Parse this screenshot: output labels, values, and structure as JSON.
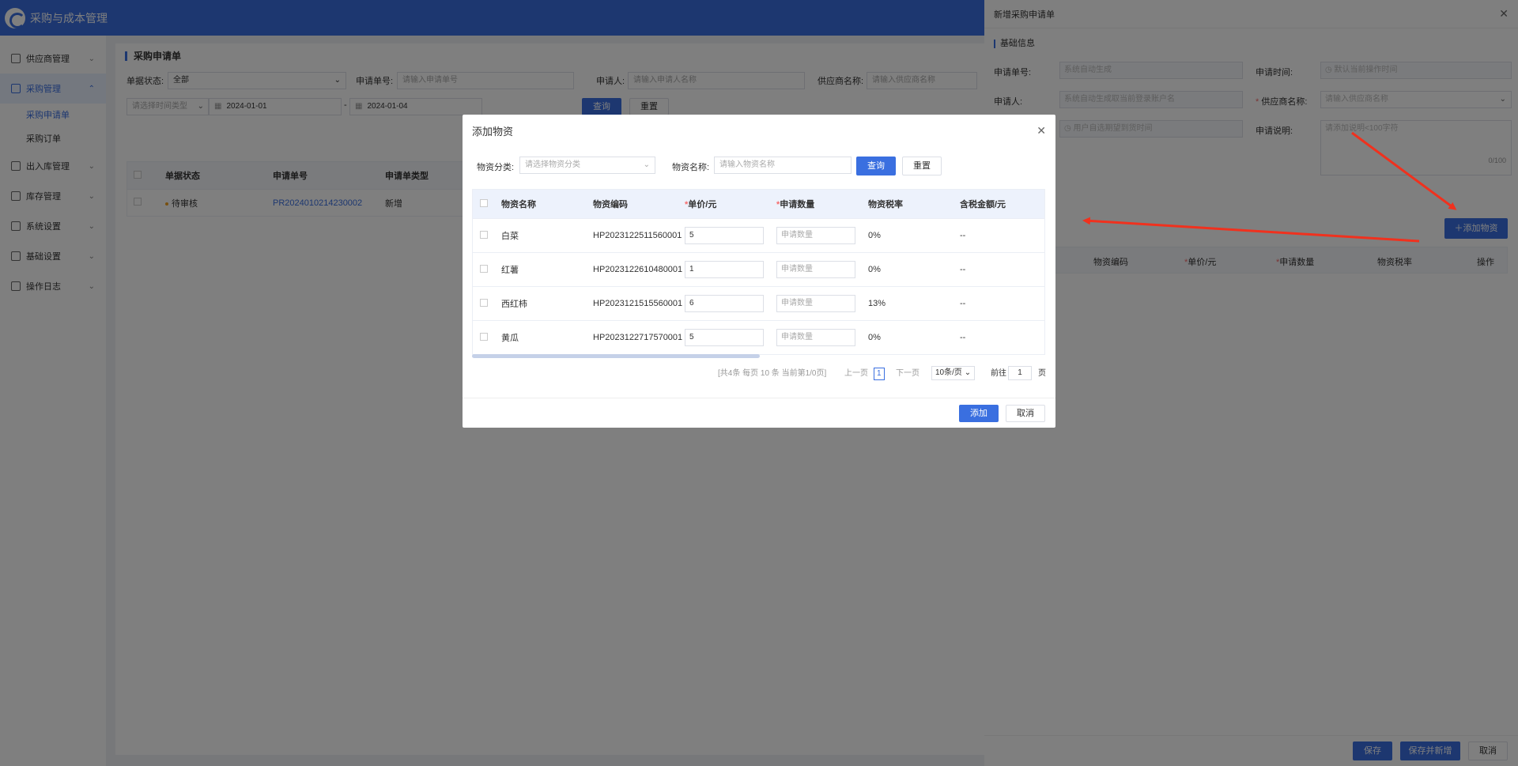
{
  "app": {
    "title": "采购与成本管理"
  },
  "sidebar": {
    "items": [
      {
        "label": "供应商管理"
      },
      {
        "label": "采购管理"
      },
      {
        "label": "出入库管理"
      },
      {
        "label": "库存管理"
      },
      {
        "label": "系统设置"
      },
      {
        "label": "基础设置"
      },
      {
        "label": "操作日志"
      }
    ],
    "sub_items": [
      {
        "label": "采购申请单"
      },
      {
        "label": "采购订单"
      }
    ]
  },
  "page": {
    "title": "采购申请单",
    "filters": {
      "status_label": "单据状态:",
      "status_value": "全部",
      "req_no_label": "申请单号:",
      "req_no_placeholder": "请输入申请单号",
      "applicant_label": "申请人:",
      "applicant_placeholder": "请输入申请人名称",
      "supplier_label": "供应商名称:",
      "supplier_placeholder": "请输入供应商名称",
      "time_type_placeholder": "请选择时间类型",
      "date_start": "2024-01-01",
      "date_sep": "-",
      "date_end": "2024-01-04",
      "query": "查询",
      "reset": "重置"
    },
    "table": {
      "headers": [
        "单据状态",
        "申请单号",
        "申请单类型"
      ],
      "rows": [
        {
          "status": "待审核",
          "no": "PR2024010214230002",
          "type": "新增"
        }
      ]
    }
  },
  "drawer": {
    "title": "新增采购申请单",
    "section": "基础信息",
    "fields": {
      "req_no_label": "申请单号:",
      "req_no_placeholder": "系统自动生成",
      "req_time_label": "申请时间:",
      "req_time_placeholder": "默认当前操作时间",
      "applicant_label": "申请人:",
      "applicant_placeholder": "系统自动生成取当前登录账户名",
      "supplier_label": "供应商名称:",
      "supplier_placeholder": "请输入供应商名称",
      "expected_time_placeholder": "用户自选期望到货时间",
      "desc_label": "申请说明:",
      "desc_placeholder": "请添加说明<100字符",
      "desc_counter": "0/100"
    },
    "add_material": "添加物资",
    "table_headers": [
      "物资编码",
      "单价/元",
      "申请数量",
      "物资税率",
      "操作"
    ],
    "footer": {
      "save": "保存",
      "save_new": "保存并新增",
      "cancel": "取消"
    }
  },
  "modal": {
    "title": "添加物资",
    "filters": {
      "category_label": "物资分类:",
      "category_placeholder": "请选择物资分类",
      "name_label": "物资名称:",
      "name_placeholder": "请输入物资名称",
      "query": "查询",
      "reset": "重置"
    },
    "headers": [
      "物资名称",
      "物资编码",
      "单价/元",
      "申请数量",
      "物资税率",
      "含税金额/元"
    ],
    "qty_placeholder": "申请数量",
    "rows": [
      {
        "name": "白菜",
        "code": "HP2023122511560001",
        "price": "5",
        "tax": "0%",
        "amount": "--"
      },
      {
        "name": "红薯",
        "code": "HP2023122610480001",
        "price": "1",
        "tax": "0%",
        "amount": "--"
      },
      {
        "name": "西红柿",
        "code": "HP2023121515560001",
        "price": "6",
        "tax": "13%",
        "amount": "--"
      },
      {
        "name": "黄瓜",
        "code": "HP2023122717570001",
        "price": "5",
        "tax": "0%",
        "amount": "--"
      }
    ],
    "pager": {
      "summary": "[共4条 每页 10 条 当前第1/0页]",
      "prev": "上一页",
      "current": "1",
      "next": "下一页",
      "page_size": "10条/页",
      "goto_label": "前往",
      "goto_value": "1",
      "page_unit": "页"
    },
    "footer": {
      "add": "添加",
      "cancel": "取消"
    }
  },
  "colors": {
    "primary": "#3a6fe0",
    "arrow": "#f0311e",
    "required": "#f56c6c"
  }
}
